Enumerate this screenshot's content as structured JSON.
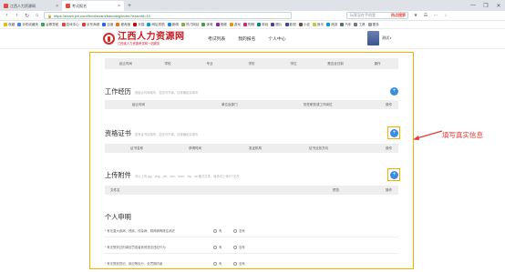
{
  "browser": {
    "tabs": [
      {
        "label": "江西人力资源网",
        "active": false
      },
      {
        "label": "考试报名",
        "active": true
      }
    ],
    "new_tab": "+",
    "window_controls": [
      "—",
      "❐",
      "✕"
    ],
    "nav_buttons": [
      "‹",
      "›",
      "↻",
      "⌂"
    ],
    "url": "https://exam.jxrl.com/front/exam/baoming/index?examId=10",
    "search_placeholder": "玩家没在手机里",
    "search_button": "热点搜索",
    "toolbar_icons": [
      "★",
      "☰",
      "⋯",
      "↓"
    ],
    "bookmarks": [
      {
        "label": "收藏",
        "color": "#f4b400"
      },
      {
        "label": "手机收藏夹",
        "color": "#4285f4"
      },
      {
        "label": "谷歌导航",
        "color": "#34a853"
      },
      {
        "label": "游戏中心",
        "color": "#ea4335"
      },
      {
        "label": "京东商城",
        "color": "#e53935"
      },
      {
        "label": "百度",
        "color": "#2962ff"
      },
      {
        "label": "爱淘宝",
        "color": "#ff6d00"
      },
      {
        "label": "天猫",
        "color": "#d50000"
      },
      {
        "label": "网址导航",
        "color": "#00a0e9"
      },
      {
        "label": "新闻",
        "color": "#1e88e5"
      },
      {
        "label": "热门网站",
        "color": "#7cb342"
      },
      {
        "label": "体育",
        "color": "#43a047"
      },
      {
        "label": "视频",
        "color": "#8e24aa"
      },
      {
        "label": "游戏",
        "color": "#fb8c00"
      },
      {
        "label": "购物",
        "color": "#e91e63"
      },
      {
        "label": "财经",
        "color": "#00897b"
      },
      {
        "label": "图片",
        "color": "#5e35b1"
      },
      {
        "label": "影视",
        "color": "#3949ab"
      },
      {
        "label": "小说",
        "color": "#6d4c41"
      },
      {
        "label": "音乐",
        "color": "#c0ca33"
      },
      {
        "label": "旅游",
        "color": "#039be5"
      },
      {
        "label": "汽车",
        "color": "#546e7a"
      },
      {
        "label": "工具",
        "color": "#757575"
      },
      {
        "label": "更多",
        "color": "#9e9e9e"
      }
    ]
  },
  "site": {
    "logo_title": "江西人力资源网",
    "logo_subtitle": "江西省人力资源考试网一站服务",
    "nav": [
      "考试列表",
      "我的报名",
      "个人中心"
    ],
    "username": "测试"
  },
  "form": {
    "education_headers": [
      "起止时间",
      "学校",
      "专业",
      "学历",
      "学位",
      "是否全日制",
      "操作"
    ],
    "work": {
      "title": "工作经历",
      "hint": "按起止时间填写，如无可不填，请准确如实填写",
      "headers": [
        "起止时间",
        "单位及部门",
        "担任职务或工作岗位",
        "操作"
      ]
    },
    "certificate": {
      "title": "资格证书",
      "hint": "如有证书请填写，如无可不填，请准确如实填写",
      "headers": [
        "证书名称",
        "获得时间",
        "发证机构",
        "证书业务方向",
        "操作"
      ]
    },
    "attachment": {
      "title": "上传附件",
      "hint": "可以上传 jpg、png、pdf、doc、docx、zip、rar 格式文件，最多可上传5个文件",
      "headers": [
        "文件名",
        "预览",
        "操作"
      ]
    },
    "declaration": {
      "title": "个人申明",
      "items": [
        "* 有无重大疾病、残疾、传染病、精神病等既往病史",
        "* 有无受到过刑事处罚或者其他违法违纪行为",
        "* 有无受到党纪、政纪等处分，处罚期内者"
      ],
      "options": [
        "有",
        "没有"
      ]
    },
    "add_symbol": "+"
  },
  "annotation": {
    "text": "填写真实信息",
    "color": "#e53935"
  }
}
